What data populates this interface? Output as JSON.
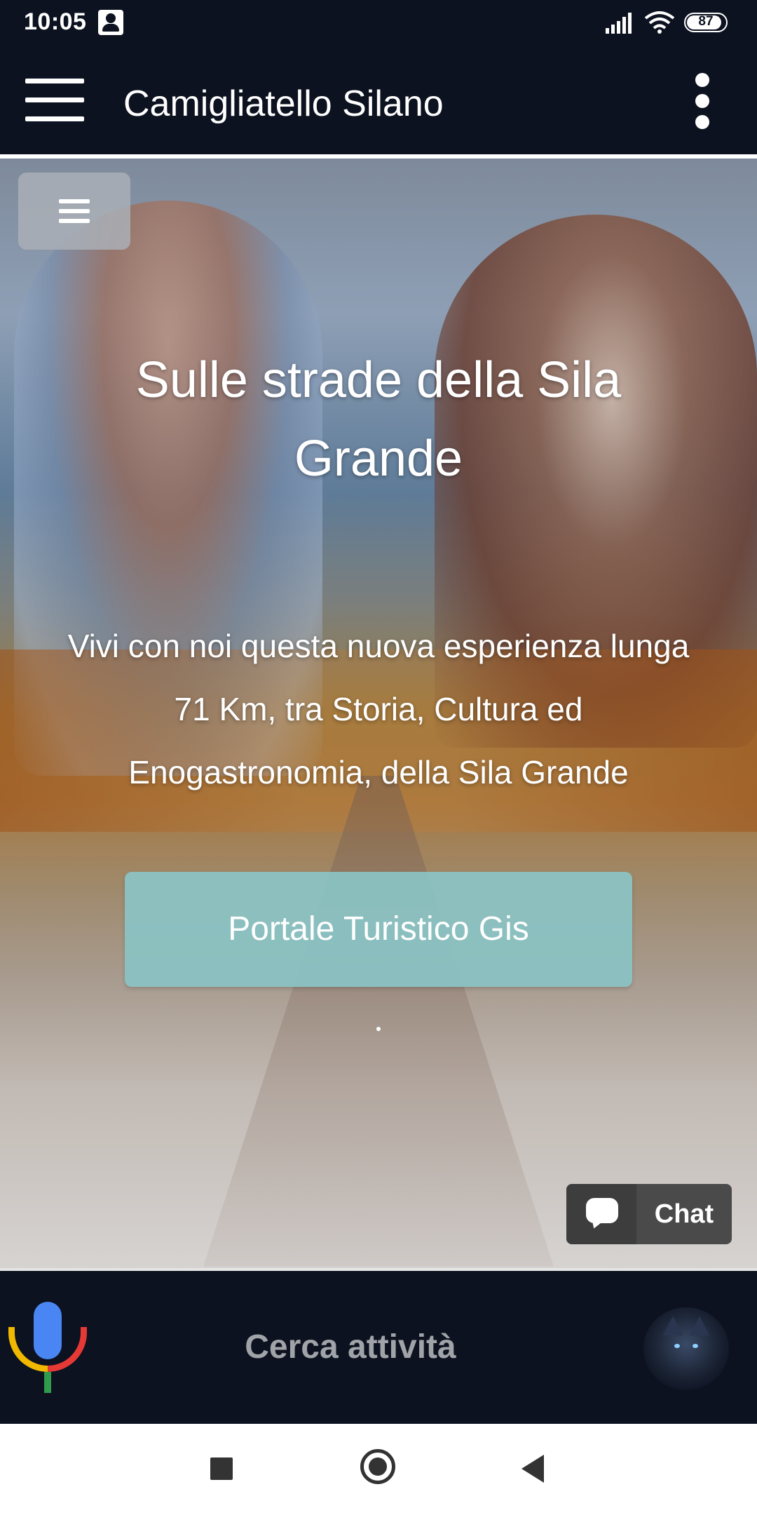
{
  "status_bar": {
    "time": "10:05",
    "battery_level": "87",
    "icons": [
      "contact-icon",
      "signal-icon",
      "wifi-icon",
      "battery-icon"
    ]
  },
  "app_bar": {
    "title": "Camigliatello Silano",
    "menu_icon": "hamburger-icon",
    "more_icon": "more-vert-icon"
  },
  "hero": {
    "menu_icon": "hamburger-icon",
    "title": "Sulle strade della Sila Grande",
    "subtitle": "Vivi con noi questa nuova esperienza lunga 71 Km, tra Storia, Cultura ed Enogastronomia, della Sila Grande",
    "cta_label": "Portale Turistico Gis",
    "cta_color": "#8ac3c4"
  },
  "chat": {
    "label": "Chat",
    "icon": "chat-bubble-icon"
  },
  "search_bar": {
    "label": "Cerca attività",
    "mic_icon": "microphone-icon",
    "avatar": "wolf-logo"
  },
  "nav_bar": {
    "icons": [
      "recents-square-icon",
      "home-circle-icon",
      "back-triangle-icon"
    ]
  },
  "colors": {
    "bar_background": "#0d1220",
    "accent": "#8ac3c4"
  }
}
